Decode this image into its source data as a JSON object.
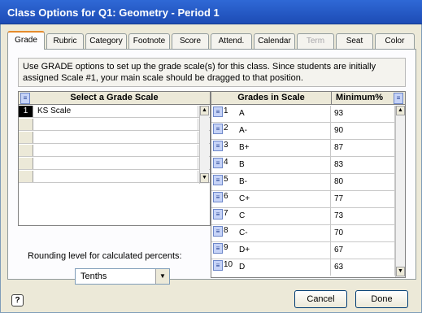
{
  "window": {
    "title": "Class Options for Q1: Geometry - Period 1"
  },
  "tabs": [
    {
      "label": "Grade",
      "active": true
    },
    {
      "label": "Rubric"
    },
    {
      "label": "Category"
    },
    {
      "label": "Footnote"
    },
    {
      "label": "Score"
    },
    {
      "label": "Attend."
    },
    {
      "label": "Calendar"
    },
    {
      "label": "Term",
      "disabled": true
    },
    {
      "label": "Seat"
    },
    {
      "label": "Color"
    }
  ],
  "info": {
    "text": "Use GRADE options to set up the grade scale(s) for this class. Since students are initially assigned Scale #1, your main scale should be dragged to that position."
  },
  "scales": {
    "header": "Select a Grade Scale",
    "rows": [
      {
        "num": "1",
        "name": "KS Scale"
      },
      {
        "num": "",
        "name": ""
      },
      {
        "num": "",
        "name": ""
      },
      {
        "num": "",
        "name": ""
      },
      {
        "num": "",
        "name": ""
      },
      {
        "num": "",
        "name": ""
      }
    ]
  },
  "grades": {
    "header_grade": "Grades in Scale",
    "header_min": "Minimum%",
    "rows": [
      {
        "num": "1",
        "grade": "A",
        "min": "93"
      },
      {
        "num": "2",
        "grade": "A-",
        "min": "90"
      },
      {
        "num": "3",
        "grade": "B+",
        "min": "87"
      },
      {
        "num": "4",
        "grade": "B",
        "min": "83"
      },
      {
        "num": "5",
        "grade": "B-",
        "min": "80"
      },
      {
        "num": "6",
        "grade": "C+",
        "min": "77"
      },
      {
        "num": "7",
        "grade": "C",
        "min": "73"
      },
      {
        "num": "8",
        "grade": "C-",
        "min": "70"
      },
      {
        "num": "9",
        "grade": "D+",
        "min": "67"
      },
      {
        "num": "10",
        "grade": "D",
        "min": "63"
      }
    ]
  },
  "rounding": {
    "label": "Rounding level for calculated percents:",
    "value": "Tenths"
  },
  "footer": {
    "help": "?",
    "cancel": "Cancel",
    "done": "Done"
  }
}
